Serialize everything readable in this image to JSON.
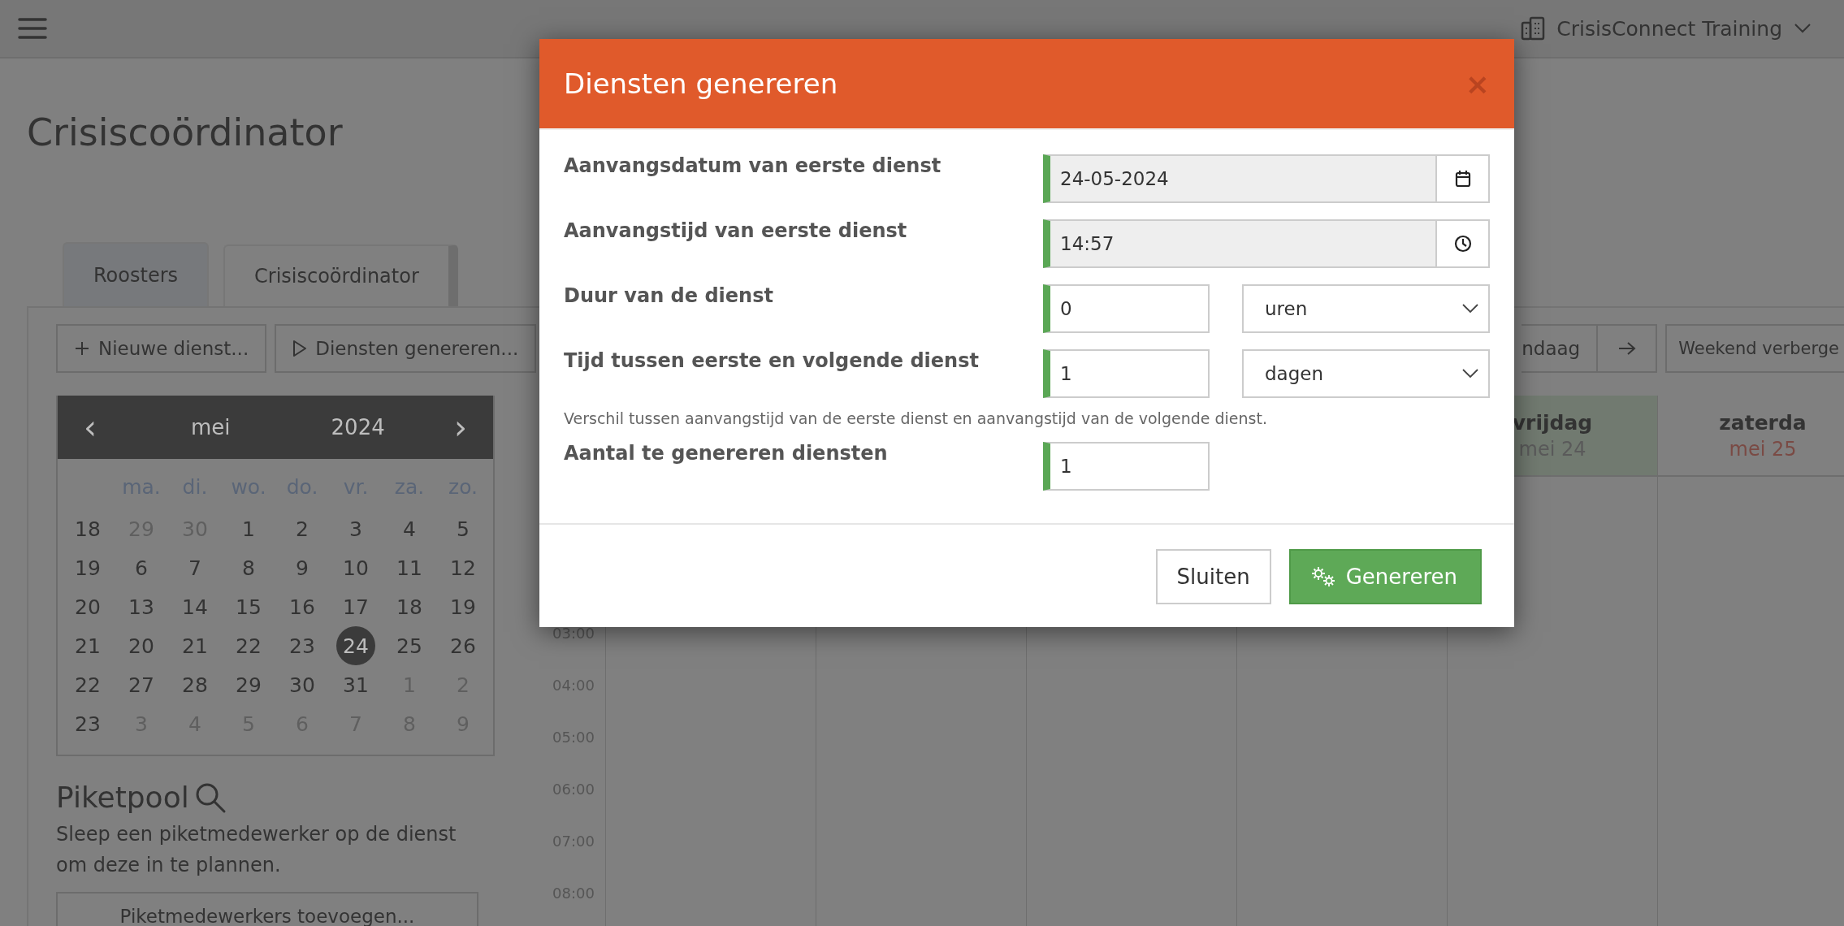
{
  "topbar": {
    "organisation": "CrisisConnect Training"
  },
  "page": {
    "title": "Crisiscoördinator"
  },
  "tabs": [
    {
      "label": "Roosters",
      "selected": false
    },
    {
      "label": "Crisiscoördinator",
      "selected": true
    }
  ],
  "toolbar": {
    "left": [
      {
        "label": "Nieuwe dienst..."
      },
      {
        "label": "Diensten genereren..."
      }
    ],
    "right": [
      {
        "kind": "text",
        "label": "ndaag"
      },
      {
        "kind": "arrow"
      },
      {
        "kind": "text",
        "label": "Weekend verberge"
      }
    ]
  },
  "mini_calendar": {
    "month": "mei",
    "year": "2024",
    "prev": "‹",
    "next": "›",
    "weekdays": [
      "ma.",
      "di.",
      "wo.",
      "do.",
      "vr.",
      "za.",
      "zo."
    ],
    "weeks": [
      {
        "week": "18",
        "days": [
          {
            "label": "29",
            "muted": true,
            "selected": false
          },
          {
            "label": "30",
            "muted": true,
            "selected": false
          },
          {
            "label": "1",
            "muted": false,
            "selected": false
          },
          {
            "label": "2",
            "muted": false,
            "selected": false
          },
          {
            "label": "3",
            "muted": false,
            "selected": false
          },
          {
            "label": "4",
            "muted": false,
            "selected": false
          },
          {
            "label": "5",
            "muted": false,
            "selected": false
          }
        ]
      },
      {
        "week": "19",
        "days": [
          {
            "label": "6",
            "muted": false,
            "selected": false
          },
          {
            "label": "7",
            "muted": false,
            "selected": false
          },
          {
            "label": "8",
            "muted": false,
            "selected": false
          },
          {
            "label": "9",
            "muted": false,
            "selected": false
          },
          {
            "label": "10",
            "muted": false,
            "selected": false
          },
          {
            "label": "11",
            "muted": false,
            "selected": false
          },
          {
            "label": "12",
            "muted": false,
            "selected": false
          }
        ]
      },
      {
        "week": "20",
        "days": [
          {
            "label": "13",
            "muted": false,
            "selected": false
          },
          {
            "label": "14",
            "muted": false,
            "selected": false
          },
          {
            "label": "15",
            "muted": false,
            "selected": false
          },
          {
            "label": "16",
            "muted": false,
            "selected": false
          },
          {
            "label": "17",
            "muted": false,
            "selected": false
          },
          {
            "label": "18",
            "muted": false,
            "selected": false
          },
          {
            "label": "19",
            "muted": false,
            "selected": false
          }
        ]
      },
      {
        "week": "21",
        "days": [
          {
            "label": "20",
            "muted": false,
            "selected": false
          },
          {
            "label": "21",
            "muted": false,
            "selected": false
          },
          {
            "label": "22",
            "muted": false,
            "selected": false
          },
          {
            "label": "23",
            "muted": false,
            "selected": false
          },
          {
            "label": "24",
            "muted": false,
            "selected": true
          },
          {
            "label": "25",
            "muted": false,
            "selected": false
          },
          {
            "label": "26",
            "muted": false,
            "selected": false
          }
        ]
      },
      {
        "week": "22",
        "days": [
          {
            "label": "27",
            "muted": false,
            "selected": false
          },
          {
            "label": "28",
            "muted": false,
            "selected": false
          },
          {
            "label": "29",
            "muted": false,
            "selected": false
          },
          {
            "label": "30",
            "muted": false,
            "selected": false
          },
          {
            "label": "31",
            "muted": false,
            "selected": false
          },
          {
            "label": "1",
            "muted": true,
            "selected": false
          },
          {
            "label": "2",
            "muted": true,
            "selected": false
          }
        ]
      },
      {
        "week": "23",
        "days": [
          {
            "label": "3",
            "muted": true,
            "selected": false
          },
          {
            "label": "4",
            "muted": true,
            "selected": false
          },
          {
            "label": "5",
            "muted": true,
            "selected": false
          },
          {
            "label": "6",
            "muted": true,
            "selected": false
          },
          {
            "label": "7",
            "muted": true,
            "selected": false
          },
          {
            "label": "8",
            "muted": true,
            "selected": false
          },
          {
            "label": "9",
            "muted": true,
            "selected": false
          }
        ]
      }
    ]
  },
  "piketpool": {
    "title": "Piketpool",
    "description": "Sleep een piketmedewerker op de dienst om deze in te plannen.",
    "button": "Piketmedewerkers toevoegen..."
  },
  "schedule": {
    "days": [
      {
        "name": "vrijdag",
        "date": "mei 24",
        "today": true,
        "weekend": false
      },
      {
        "name": "zaterda",
        "date": "mei 25",
        "today": false,
        "weekend": true
      }
    ],
    "times": [
      "03:00",
      "04:00",
      "05:00",
      "06:00",
      "07:00",
      "08:00"
    ]
  },
  "dialog": {
    "title": "Diensten genereren",
    "close": "×",
    "fields": [
      {
        "label": "Aanvangsdatum van eerste dienst",
        "kind": "date",
        "value": "24-05-2024"
      },
      {
        "label": "Aanvangstijd van eerste dienst",
        "kind": "time",
        "value": "14:57"
      },
      {
        "label": "Duur van de dienst",
        "kind": "number_unit",
        "value": "0",
        "unit": "uren"
      },
      {
        "label": "Tijd tussen eerste en volgende dienst",
        "kind": "number_unit",
        "value": "1",
        "unit": "dagen",
        "help": "Verschil tussen aanvangstijd van de eerste dienst en aanvangstijd van de volgende dienst."
      },
      {
        "label": "Aantal te genereren diensten",
        "kind": "number",
        "value": "1"
      }
    ],
    "buttons": [
      {
        "label": "Sluiten",
        "kind": "default"
      },
      {
        "label": "Genereren",
        "kind": "primary"
      }
    ]
  }
}
